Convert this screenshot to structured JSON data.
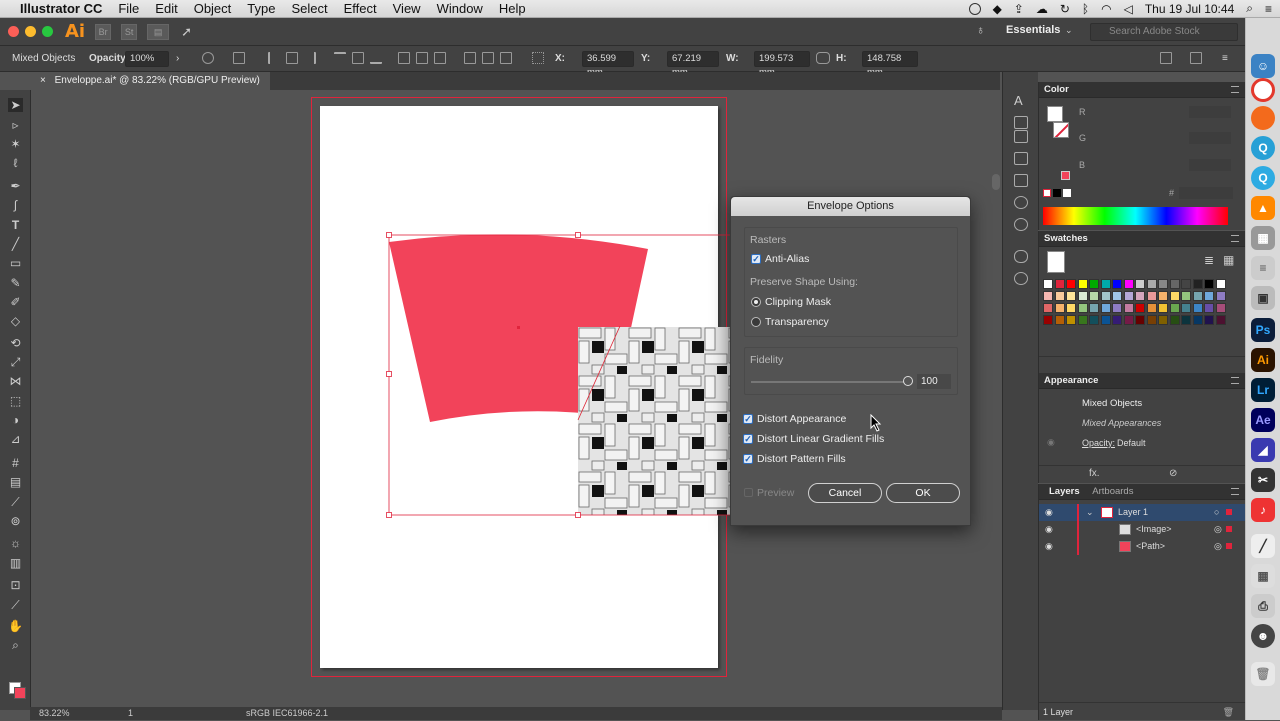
{
  "menubar": {
    "app": "Illustrator CC",
    "items": [
      "File",
      "Edit",
      "Object",
      "Type",
      "Select",
      "Effect",
      "View",
      "Window",
      "Help"
    ],
    "clock": "Thu 19 Jul  10:44"
  },
  "appbar": {
    "logo": "Ai",
    "br": "Br",
    "st": "St",
    "workspace": "Essentials",
    "search_placeholder": "Search Adobe Stock"
  },
  "control": {
    "selection": "Mixed Objects",
    "opacity_label": "Opacity:",
    "opacity": "100%",
    "x_label": "X:",
    "x": "36.599 mm",
    "y_label": "Y:",
    "y": "67.219 mm",
    "w_label": "W:",
    "w": "199.573 mm",
    "h_label": "H:",
    "h": "148.758 mm"
  },
  "document": {
    "tab": "Enveloppe.ai* @ 83.22% (RGB/GPU Preview)",
    "close": "×"
  },
  "status": {
    "zoom": "83.22%",
    "page": "1",
    "profile": "sRGB IEC61966-2.1"
  },
  "dialog": {
    "title": "Envelope Options",
    "rasters_label": "Rasters",
    "antialias": "Anti-Alias",
    "antialias_checked": true,
    "preserve_label": "Preserve Shape Using:",
    "clipping": "Clipping Mask",
    "transparency": "Transparency",
    "selected": "Clipping Mask",
    "fidelity_label": "Fidelity",
    "fidelity": "100",
    "distort_appearance": "Distort Appearance",
    "distort_gradient": "Distort Linear Gradient Fills",
    "distort_pattern": "Distort Pattern Fills",
    "preview": "Preview",
    "cancel": "Cancel",
    "ok": "OK"
  },
  "color_panel": {
    "title": "Color",
    "r": "R",
    "g": "G",
    "b": "B",
    "hash": "#"
  },
  "swatches_panel": {
    "title": "Swatches"
  },
  "appearance_panel": {
    "title": "Appearance",
    "selection": "Mixed Objects",
    "sub": "Mixed Appearances",
    "opacity_label": "Opacity:",
    "opacity": "Default",
    "fx": "fx."
  },
  "layers_panel": {
    "tab1": "Layers",
    "tab2": "Artboards",
    "layers": [
      {
        "name": "Layer 1"
      },
      {
        "name": "<Image>"
      },
      {
        "name": "<Path>"
      }
    ],
    "footer": "1 Layer"
  },
  "dock": {
    "ps": "Ps",
    "ai": "Ai",
    "lr": "Lr",
    "ae": "Ae"
  },
  "colors": {
    "accent": "#f2435a",
    "selection": "#e0243c",
    "panel": "#424242",
    "workspace": "#535353"
  }
}
